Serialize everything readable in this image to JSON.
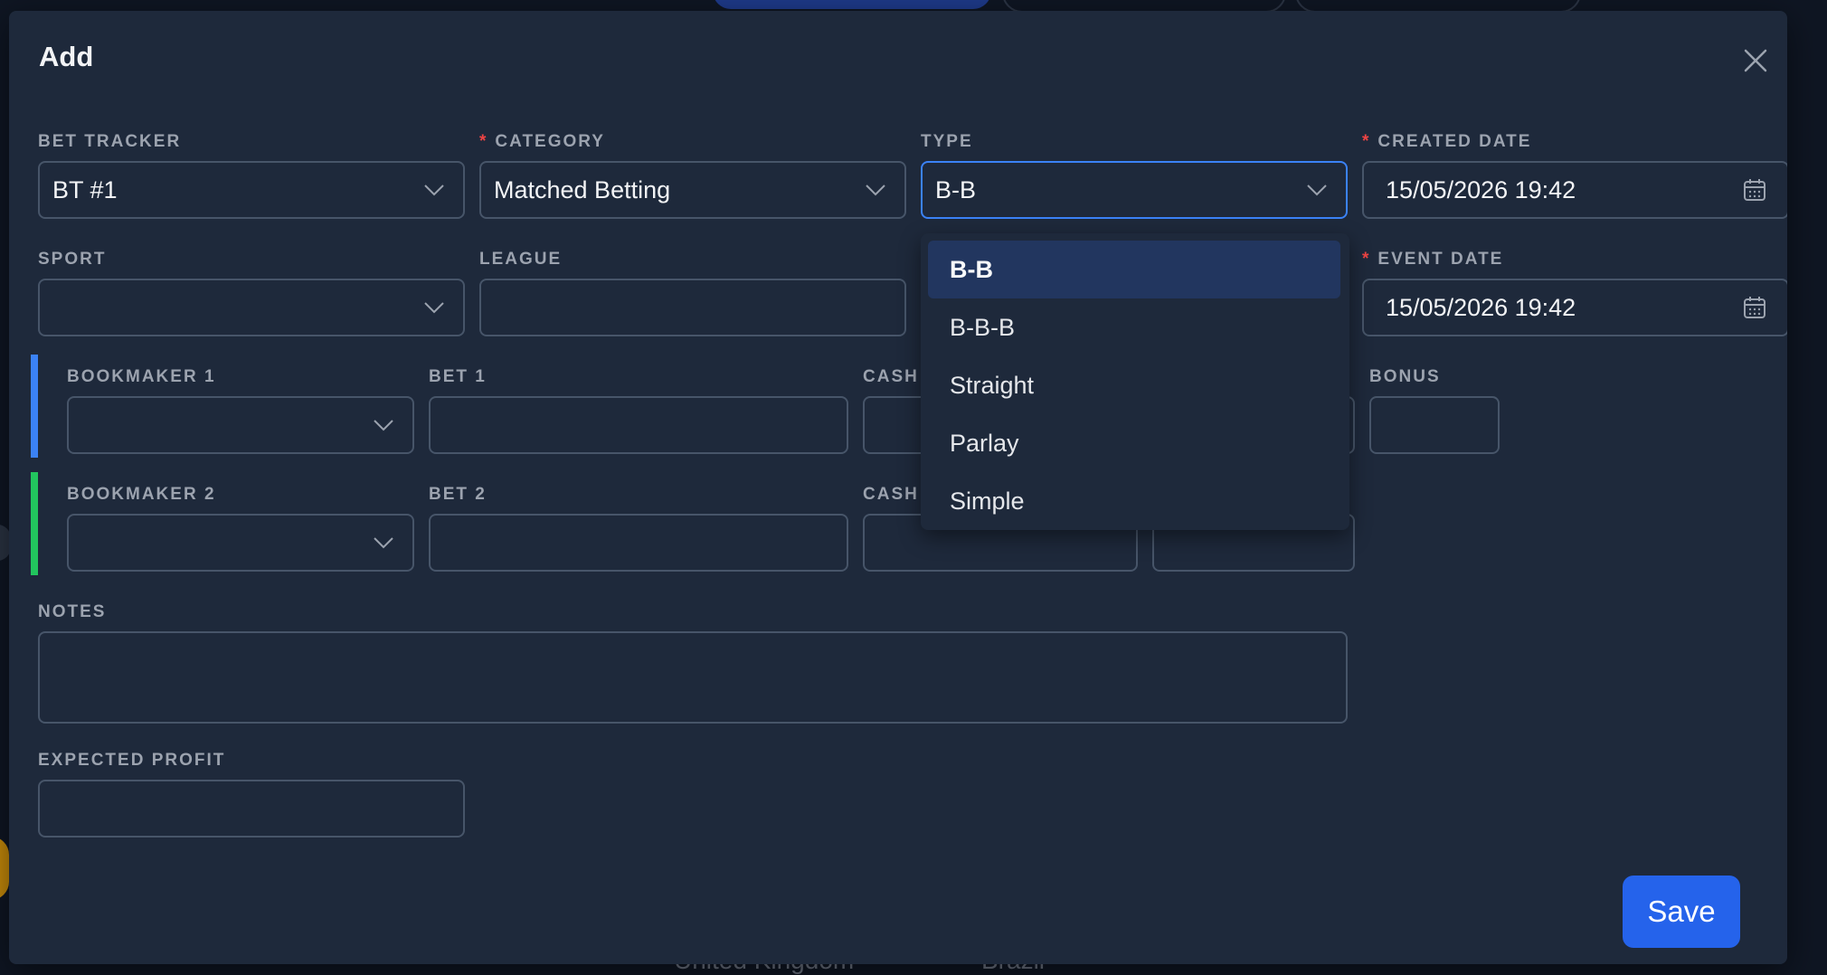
{
  "modal": {
    "title": "Add",
    "save_label": "Save"
  },
  "fields": {
    "bet_tracker": {
      "label": "BET TRACKER",
      "value": "BT #1"
    },
    "category": {
      "label": "CATEGORY",
      "required_mark": "*",
      "value": "Matched Betting"
    },
    "type": {
      "label": "TYPE",
      "value": "B-B"
    },
    "created_date": {
      "label": "CREATED DATE",
      "required_mark": "*",
      "value": "15/05/2026 19:42"
    },
    "sport": {
      "label": "SPORT",
      "value": ""
    },
    "league": {
      "label": "LEAGUE",
      "value": ""
    },
    "event_date": {
      "label": "EVENT DATE",
      "required_mark": "*",
      "value": "15/05/2026 19:42"
    },
    "bookmaker1": {
      "label": "BOOKMAKER 1",
      "value": ""
    },
    "bet1": {
      "label": "BET 1",
      "value": ""
    },
    "cash1": {
      "label": "CASH",
      "value": ""
    },
    "bonus1": {
      "label": "BONUS",
      "value": ""
    },
    "bookmaker2": {
      "label": "BOOKMAKER 2",
      "value": ""
    },
    "bet2": {
      "label": "BET 2",
      "value": ""
    },
    "cash2": {
      "label": "CASH",
      "value": ""
    },
    "notes": {
      "label": "NOTES",
      "value": ""
    },
    "expected_profit": {
      "label": "EXPECTED PROFIT",
      "value": ""
    }
  },
  "type_dropdown": {
    "options": [
      "B-B",
      "B-B-B",
      "Straight",
      "Parlay",
      "Simple"
    ],
    "selected": "B-B"
  },
  "background": {
    "bottom_text_1": "United Kingdom",
    "bottom_text_2": "Brazil"
  },
  "colors": {
    "modal_bg": "#1e293b",
    "accent": "#2563eb",
    "stripe_1": "#3b82f6",
    "stripe_2": "#22c55e",
    "required": "#ef4444"
  },
  "icons": {
    "close": "close-icon",
    "dropdown": "chevron-down-icon",
    "date": "calendar-icon"
  }
}
